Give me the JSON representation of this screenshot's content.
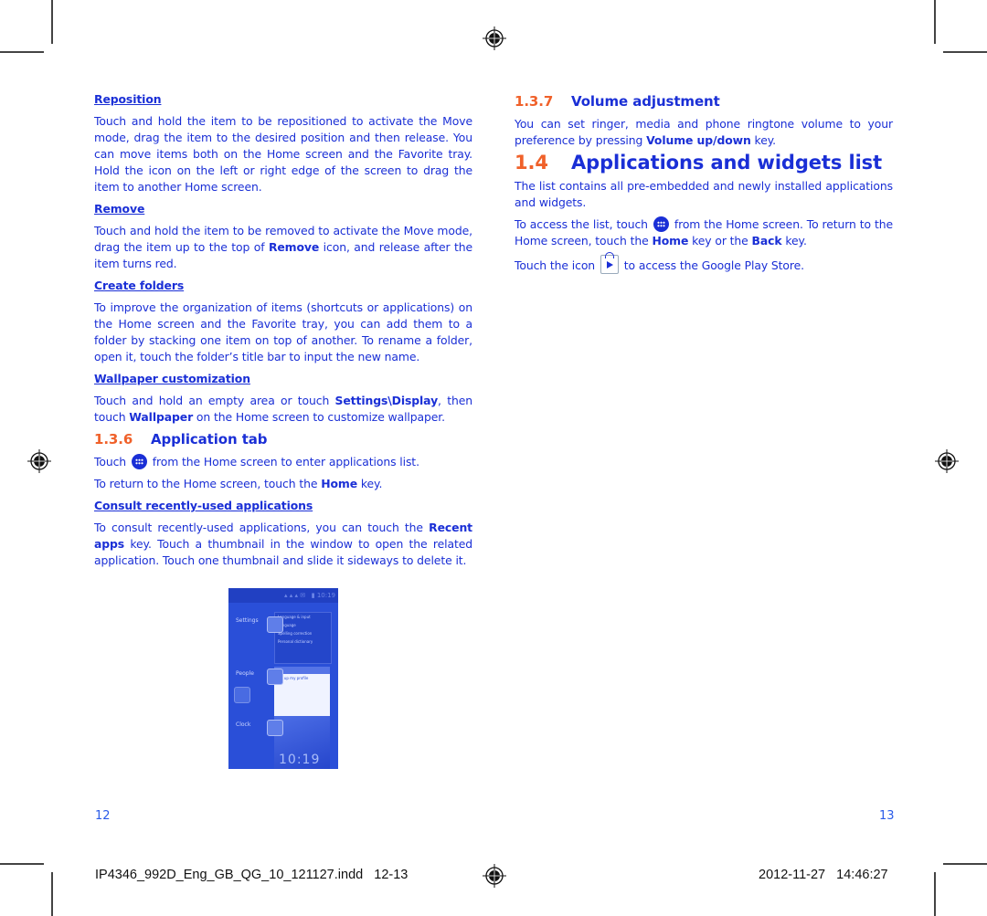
{
  "left_page": {
    "sections": {
      "reposition": {
        "heading": "Reposition",
        "body": "Touch and hold the item to be repositioned to activate the Move mode, drag the item to the desired position and then release. You can move items both on the Home screen and the Favorite tray. Hold the icon on the left or right edge of the screen to drag the item to another Home screen."
      },
      "remove": {
        "heading": "Remove",
        "body_pre": "Touch and hold the item to be removed to activate the Move mode, drag the item up to the top of ",
        "body_bold": "Remove",
        "body_post": " icon, and release after the item turns red."
      },
      "create_folders": {
        "heading": "Create folders",
        "body": "To improve the organization of items (shortcuts or applications) on the Home screen and the Favorite tray, you can add them to a folder by stacking one item on top of another. To rename a folder, open it, touch the folder’s title bar to input the new name."
      },
      "wallpaper": {
        "heading": "Wallpaper customization",
        "body_1": "Touch and hold an empty area or touch ",
        "bold_1": "Settings\\Display",
        "body_2": ", then touch ",
        "bold_2": "Wallpaper",
        "body_3": " on the Home screen to customize wallpaper."
      }
    },
    "application_tab": {
      "number": "1.3.6",
      "title": "Application tab",
      "line1_pre": "Touch",
      "line1_post": "from the Home screen to enter applications list.",
      "line2_pre": "To return to the Home screen, touch the ",
      "line2_bold": "Home",
      "line2_post": " key.",
      "recent": {
        "heading": "Consult recently-used applications",
        "body_1": "To consult recently-used applications, you can touch the ",
        "bold_1": "Recent apps",
        "body_2": " key. Touch a thumbnail in the window to open the related application. Touch one thumbnail and slide it sideways to delete it."
      }
    },
    "screenshot": {
      "labels": [
        "Settings",
        "People",
        "Clock"
      ],
      "card1_lines": [
        "Language & input",
        "Language",
        "Spelling correction",
        "Personal dictionary"
      ],
      "card2_line": "Set up my profile",
      "clock": "10:19"
    },
    "page_number": "12"
  },
  "right_page": {
    "volume": {
      "number": "1.3.7",
      "title": "Volume adjustment",
      "body_pre": "You can set ringer, media and phone ringtone volume to your preference by pressing ",
      "body_bold": "Volume up/down",
      "body_post": " key."
    },
    "apps_widgets": {
      "number": "1.4",
      "title": "Applications and widgets list",
      "p1": "The list contains all pre-embedded and newly installed applications and widgets.",
      "p2_pre": "To access the list, touch",
      "p2_mid": "from the Home screen. To return to the Home screen, touch the ",
      "p2_bold1": "Home",
      "p2_mid2": " key or the ",
      "p2_bold2": "Back",
      "p2_post": " key.",
      "p3_pre": "Touch the icon",
      "p3_post": "to access the Google Play Store."
    },
    "page_number": "13"
  },
  "slug": {
    "filename": "IP4346_992D_Eng_GB_QG_10_121127.indd   12-13",
    "timestamp": "2012-11-27   14:46:27"
  },
  "colors": {
    "text": "#1a2fd6",
    "heading_number": "#f0612a",
    "slug_text": "#111111"
  }
}
